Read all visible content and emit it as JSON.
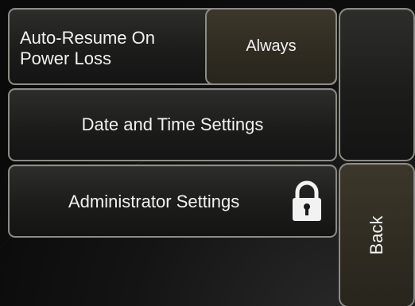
{
  "settings": {
    "auto_resume": {
      "label": "Auto-Resume On Power Loss",
      "value": "Always"
    },
    "date_time": {
      "label": "Date and Time Settings"
    },
    "administrator": {
      "label": "Administrator Settings",
      "icon": "lock-icon"
    }
  },
  "nav": {
    "back_label": "Back"
  },
  "colors": {
    "panel_border": "#8c8c86",
    "accent_button": "#2f2b21",
    "text": "#f2f2f2",
    "background": "#0c0c0c"
  }
}
